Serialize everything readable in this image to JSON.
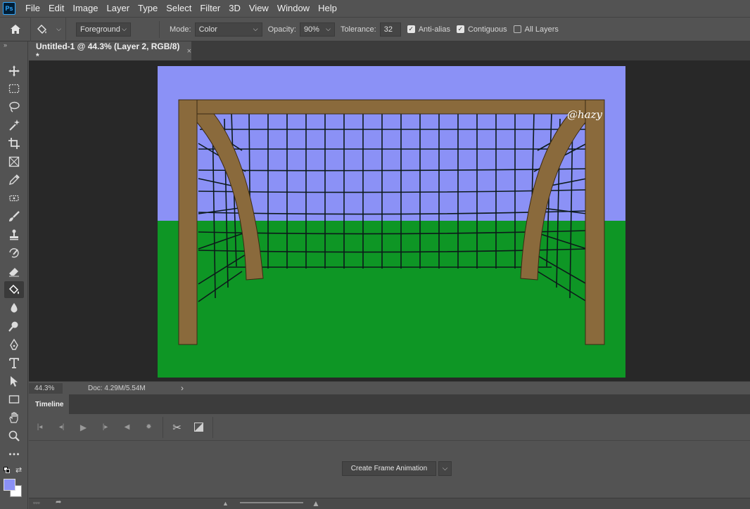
{
  "app": {
    "logo_text": "Ps",
    "menu": [
      "File",
      "Edit",
      "Image",
      "Layer",
      "Type",
      "Select",
      "Filter",
      "3D",
      "View",
      "Window",
      "Help"
    ]
  },
  "options": {
    "fill_source": "Foreground",
    "mode_label": "Mode:",
    "mode_value": "Color",
    "opacity_label": "Opacity:",
    "opacity_value": "90%",
    "tolerance_label": "Tolerance:",
    "tolerance_value": "32",
    "antialias_label": "Anti-alias",
    "antialias_checked": true,
    "contiguous_label": "Contiguous",
    "contiguous_checked": true,
    "all_layers_label": "All Layers",
    "all_layers_checked": false
  },
  "document": {
    "tab_title": "Untitled-1 @ 44.3% (Layer 2, RGB/8) *",
    "close_glyph": "×",
    "signature": "@hazy"
  },
  "status": {
    "zoom": "44.3%",
    "doc_info": "Doc: 4.29M/5.54M",
    "arrow": "›"
  },
  "timeline": {
    "tab_label": "Timeline",
    "create_button": "Create Frame Animation"
  },
  "colors": {
    "foreground": "#8b91f6",
    "background": "#ffffff",
    "sky": "#8b91f6",
    "grass": "#0e9625",
    "post": "#8a6a3c"
  }
}
